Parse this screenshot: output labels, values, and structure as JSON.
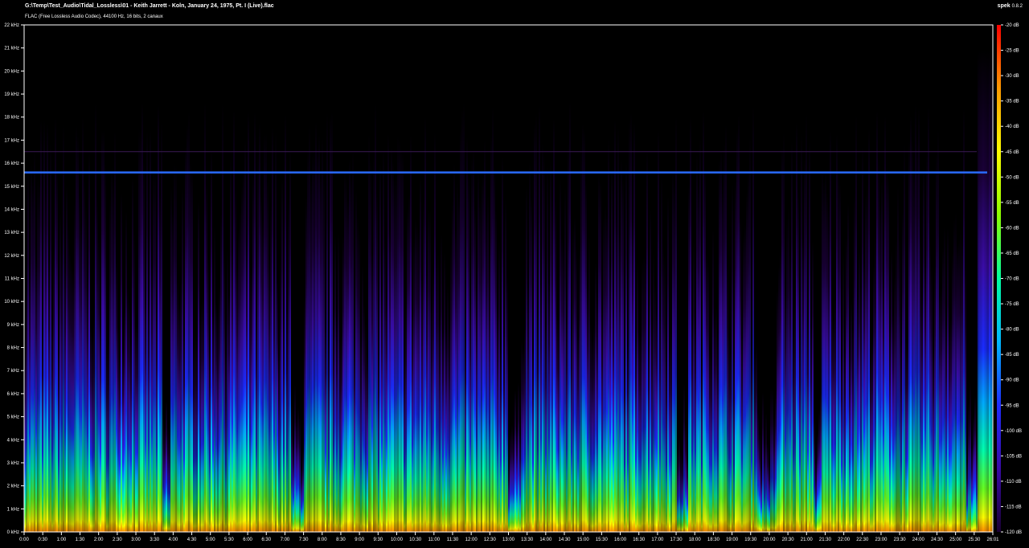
{
  "header": {
    "file_title": "G:\\Temp\\Test_Audio\\Tidal_Lossless\\01 - Keith Jarrett - Koln, January 24, 1975, Pt. I (Live).flac",
    "file_info": "FLAC (Free Lossless Audio Codec), 44100 Hz, 16 bits, 2 canaux",
    "app_name": "spek",
    "app_version": "0.8.2"
  },
  "colors": {
    "background": "#000000",
    "scale": [
      "#000000",
      "#1a0033",
      "#3a0ba8",
      "#1f2dff",
      "#00b7ff",
      "#00ffa0",
      "#8cff00",
      "#ffff00",
      "#ff9900",
      "#ff0000"
    ]
  },
  "chart_data": {
    "type": "heatmap",
    "title": "",
    "xlabel": "",
    "ylabel": "",
    "x_ticks": [
      "0:00",
      "0:30",
      "1:00",
      "1:30",
      "2:00",
      "2:30",
      "3:00",
      "3:30",
      "4:00",
      "4:30",
      "5:00",
      "5:30",
      "6:00",
      "6:30",
      "7:00",
      "7:30",
      "8:00",
      "8:30",
      "9:00",
      "9:30",
      "10:00",
      "10:30",
      "11:00",
      "11:30",
      "12:00",
      "12:30",
      "13:00",
      "13:30",
      "14:00",
      "14:30",
      "15:00",
      "15:30",
      "16:00",
      "16:30",
      "17:00",
      "17:30",
      "18:00",
      "18:30",
      "19:00",
      "19:30",
      "20:00",
      "20:30",
      "21:00",
      "21:30",
      "22:00",
      "22:30",
      "23:00",
      "23:30",
      "24:00",
      "24:30",
      "25:00",
      "25:30",
      "26:01"
    ],
    "y_ticks": [
      "0 kHz",
      "1 kHz",
      "2 kHz",
      "3 kHz",
      "4 kHz",
      "5 kHz",
      "6 kHz",
      "7 kHz",
      "8 kHz",
      "9 kHz",
      "10 kHz",
      "11 kHz",
      "12 kHz",
      "13 kHz",
      "14 kHz",
      "15 kHz",
      "16 kHz",
      "17 kHz",
      "18 kHz",
      "19 kHz",
      "20 kHz",
      "21 kHz",
      "22 kHz"
    ],
    "color_scale_ticks": [
      "-20 dB",
      "-25 dB",
      "-30 dB",
      "-35 dB",
      "-40 dB",
      "-45 dB",
      "-50 dB",
      "-55 dB",
      "-60 dB",
      "-65 dB",
      "-70 dB",
      "-75 dB",
      "-80 dB",
      "-85 dB",
      "-90 dB",
      "-95 dB",
      "-100 dB",
      "-105 dB",
      "-110 dB",
      "-115 dB",
      "-120 dB"
    ],
    "x_range_seconds": [
      0,
      1561
    ],
    "y_range_khz": [
      0,
      22
    ],
    "db_range": [
      -120,
      -20
    ],
    "tone_line_khz": 15.6,
    "faint_line_khz": 16.5,
    "grid": false,
    "legend": "right"
  }
}
